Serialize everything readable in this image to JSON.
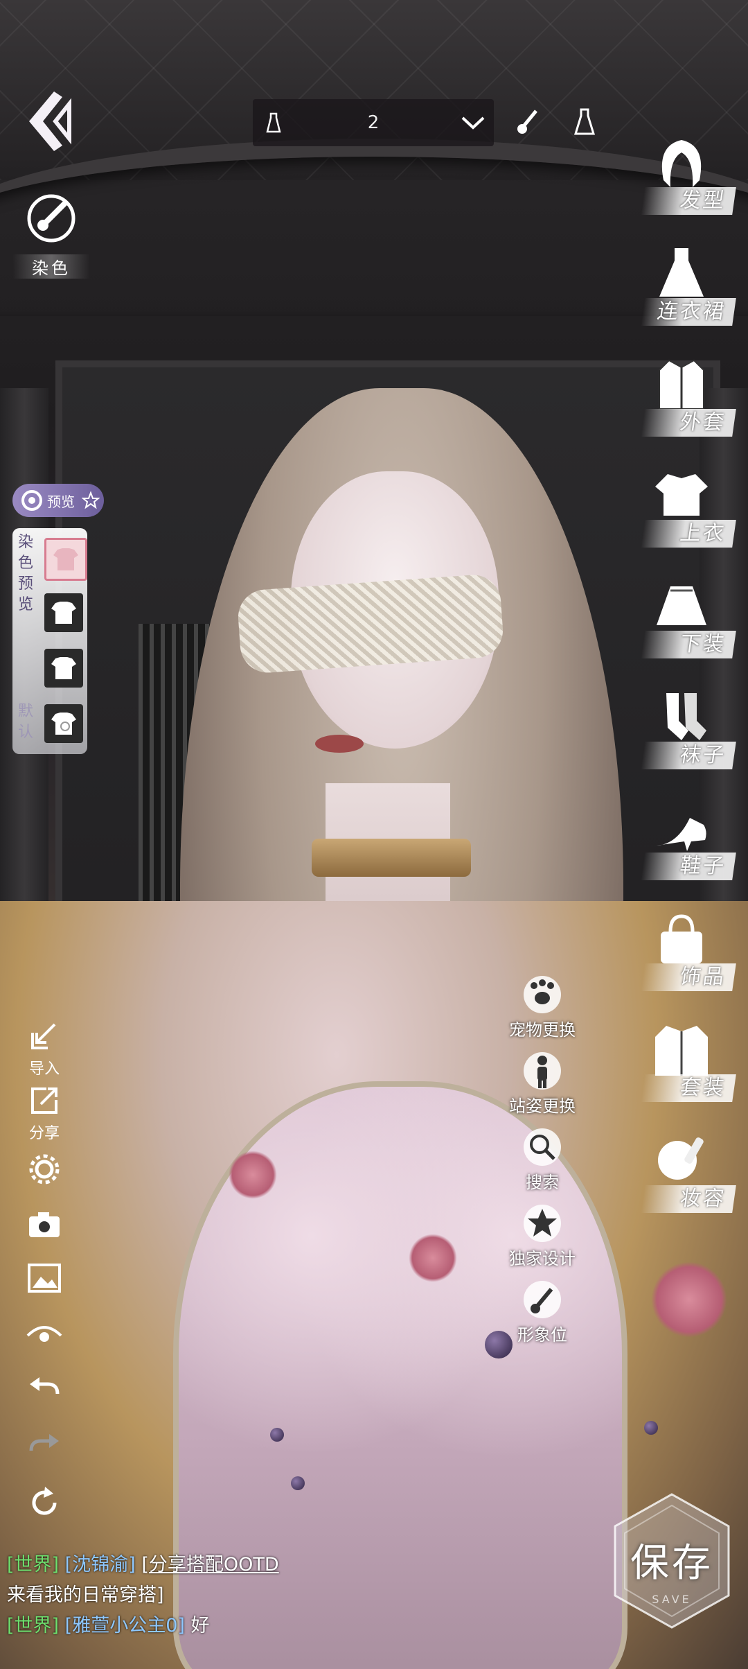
{
  "top_bar": {
    "outfit_slot_number": "2"
  },
  "dye": {
    "label": "染色"
  },
  "categories": [
    {
      "id": "hairstyle",
      "label": "发型",
      "icon": "hair-icon"
    },
    {
      "id": "dress",
      "label": "连衣裙",
      "icon": "dress-icon"
    },
    {
      "id": "coat",
      "label": "外套",
      "icon": "coat-icon"
    },
    {
      "id": "top",
      "label": "上衣",
      "icon": "top-icon"
    },
    {
      "id": "bottom",
      "label": "下装",
      "icon": "skirt-icon"
    },
    {
      "id": "socks",
      "label": "袜子",
      "icon": "socks-icon"
    },
    {
      "id": "shoes",
      "label": "鞋子",
      "icon": "high-heel-icon"
    },
    {
      "id": "accessory",
      "label": "饰品",
      "icon": "handbag-icon"
    },
    {
      "id": "suit",
      "label": "套装",
      "icon": "suit-icon"
    },
    {
      "id": "makeup",
      "label": "妆容",
      "icon": "makeup-icon"
    }
  ],
  "preview": {
    "toggle_label": "预览",
    "vertical_label": "染色预览",
    "default_label": "默认"
  },
  "left_tools": {
    "import_label": "导入",
    "share_label": "分享"
  },
  "mid_tools": [
    {
      "label": "宠物更换",
      "icon": "paw-icon"
    },
    {
      "label": "站姿更换",
      "icon": "person-icon"
    },
    {
      "label": "搜索",
      "icon": "search-icon"
    },
    {
      "label": "独家设计",
      "icon": "star-icon"
    },
    {
      "label": "形象位",
      "icon": "brush-icon"
    }
  ],
  "chat": [
    {
      "tag": "[世界]",
      "name": "[沈锦渝]",
      "link": "[分享搭配OOTD",
      "text": ""
    },
    {
      "tag": "",
      "name": "",
      "link": "",
      "text": "来看我的日常穿搭]"
    },
    {
      "tag": "[世界]",
      "name": "[雅萱小公主0]",
      "link": "",
      "text": "好"
    }
  ],
  "save": {
    "label": "保存",
    "sub_label": "SAVE"
  },
  "colors": {
    "accent": "#6d5f9c",
    "chat_tag": "#6ee06e",
    "chat_name": "#8ec8ff"
  }
}
